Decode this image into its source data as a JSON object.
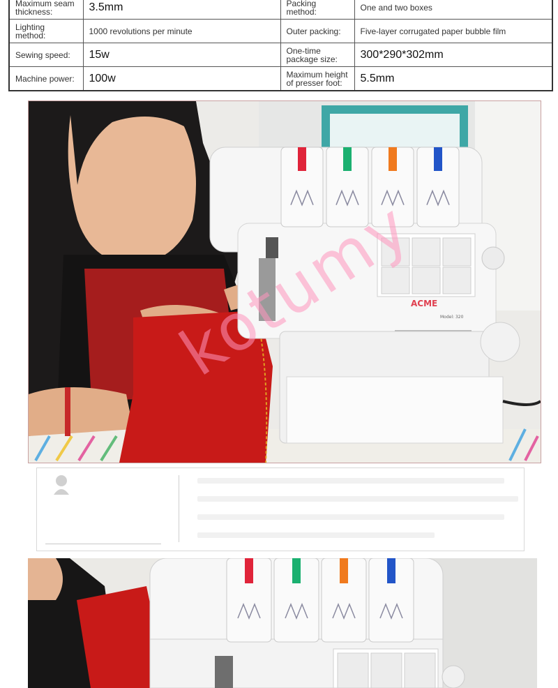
{
  "specs": {
    "rows": [
      {
        "label1": "Maximum seam thickness:",
        "value1": "3.5mm",
        "label2": "Packing method:",
        "value2": "One and two boxes"
      },
      {
        "label1": "Lighting method:",
        "value1": "1000 revolutions per minute",
        "label2": "Outer packing:",
        "value2": "Five-layer corrugated paper bubble film"
      },
      {
        "label1": "Sewing speed:",
        "value1": "15w",
        "label2": "One-time package size:",
        "value2": "300*290*302mm"
      },
      {
        "label1": "Machine power:",
        "value1": "100w",
        "label2": "Maximum height of presser foot:",
        "value2": "5.5mm"
      }
    ]
  },
  "photo1": {
    "watermark": "kotumy",
    "machine_brand": "ACME",
    "machine_model": "Model: 320",
    "thread_colors": [
      "#e0243a",
      "#1bb070",
      "#f07a1e",
      "#2255c8"
    ]
  },
  "photo2": {
    "thread_colors": [
      "#e0243a",
      "#1bb070",
      "#f07a1e",
      "#2255c8"
    ]
  }
}
